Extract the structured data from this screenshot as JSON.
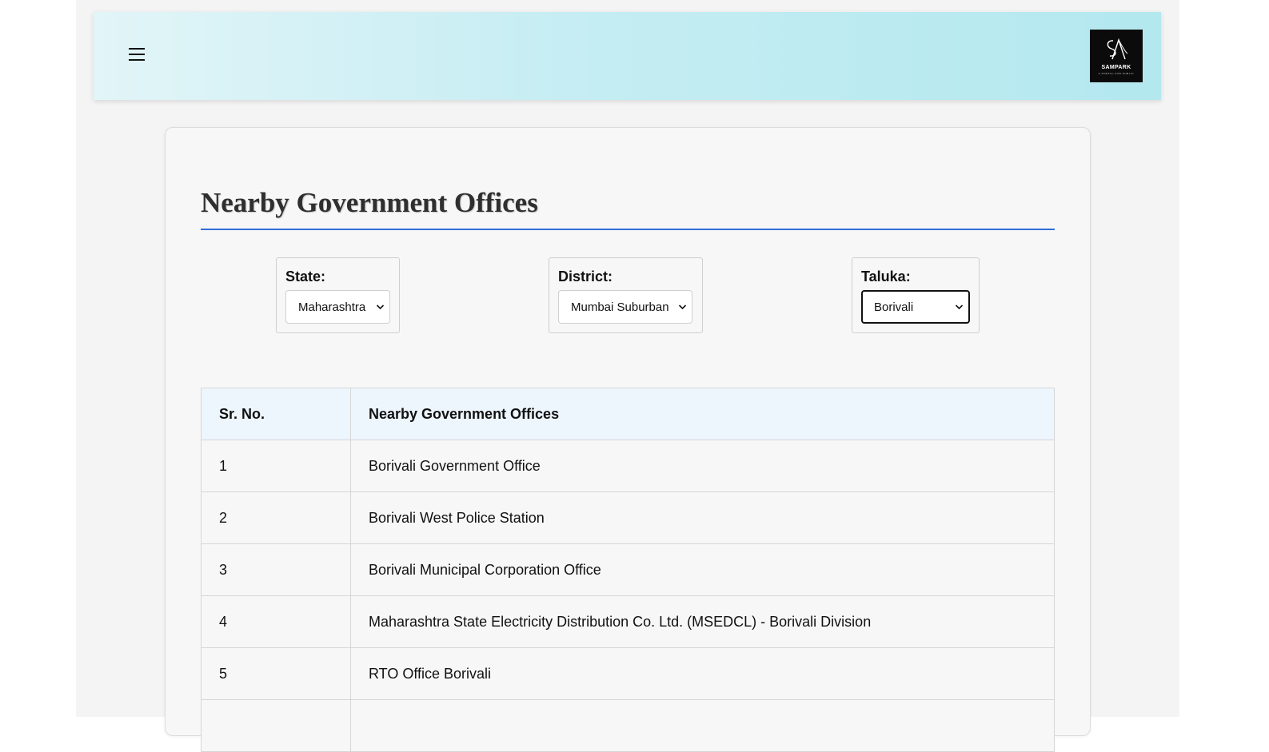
{
  "header": {
    "menu_icon": "hamburger-menu-icon",
    "logo": {
      "name": "SAMPARK",
      "tagline": "A PORTAL FOR PUBLIC",
      "colors": {
        "background": "#0b0b0b",
        "mark": "#ffffff"
      }
    }
  },
  "section": {
    "title": "Nearby Government Offices",
    "accent_color": "#2f6fd8"
  },
  "filters": {
    "state": {
      "label": "State:",
      "selected": "Maharashtra"
    },
    "district": {
      "label": "District:",
      "selected": "Mumbai Suburban"
    },
    "taluka": {
      "label": "Taluka:",
      "selected": "Borivali"
    }
  },
  "table": {
    "headers": [
      "Sr. No.",
      "Nearby Government Offices"
    ],
    "rows": [
      {
        "sr": "1",
        "office": "Borivali Government Office"
      },
      {
        "sr": "2",
        "office": "Borivali West Police Station"
      },
      {
        "sr": "3",
        "office": "Borivali Municipal Corporation Office"
      },
      {
        "sr": "4",
        "office": "Maharashtra State Electricity Distribution Co. Ltd. (MSEDCL) - Borivali Division"
      },
      {
        "sr": "5",
        "office": "RTO Office Borivali"
      },
      {
        "sr": "",
        "office": ""
      }
    ]
  }
}
